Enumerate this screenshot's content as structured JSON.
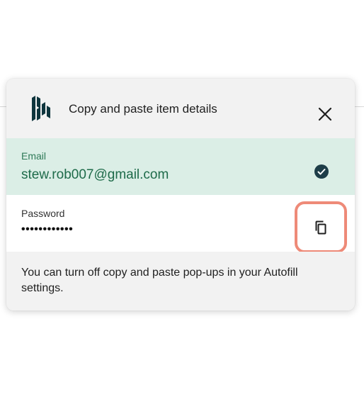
{
  "header": {
    "logo_icon": "dashlane-logo-icon",
    "title": "Copy and paste item details",
    "close_icon": "close-icon"
  },
  "fields": {
    "email": {
      "label": "Email",
      "value": "stew.rob007@gmail.com",
      "status_icon": "check-circle-icon",
      "copied": true
    },
    "password": {
      "label": "Password",
      "value": "••••••••••••",
      "action_icon": "copy-icon"
    }
  },
  "footer": {
    "text": "You can turn off copy and paste pop-ups in your Autofill settings."
  },
  "colors": {
    "brand": "#0e353d",
    "email_row_bg": "#dbeee6",
    "email_text": "#1e6b4a",
    "highlight_outline": "#ee8a78",
    "popup_bg": "#f2f2f2"
  }
}
